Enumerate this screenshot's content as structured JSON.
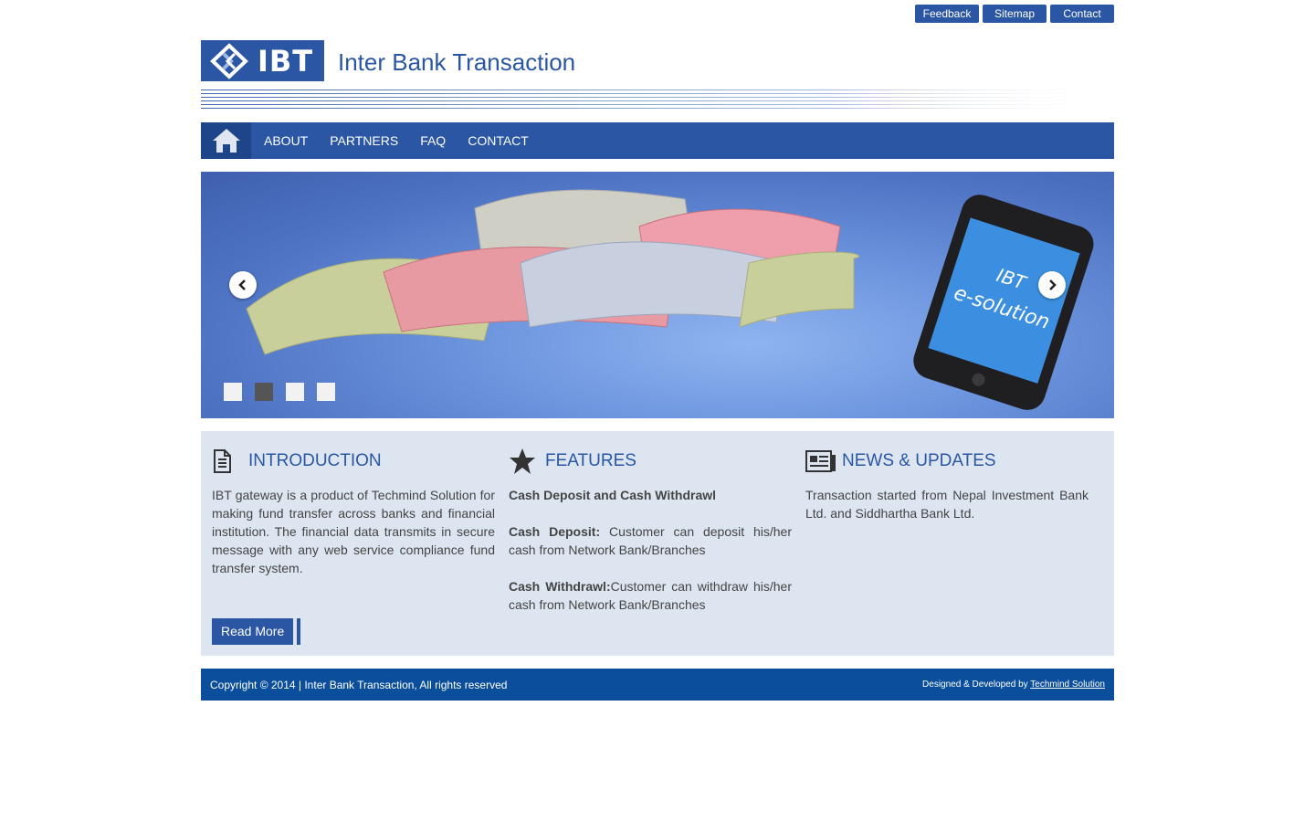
{
  "top_links": {
    "feedback": "Feedback",
    "sitemap": "Sitemap",
    "contact": "Contact"
  },
  "header": {
    "logo_text": "IBT",
    "site_title": "Inter Bank Transaction"
  },
  "nav": {
    "home_icon": "home-icon",
    "items": [
      "ABOUT",
      "PARTNERS",
      "FAQ",
      "CONTACT"
    ]
  },
  "slider": {
    "phone_text_line1": "IBT",
    "phone_text_line2": "e-solution",
    "active_slide": 2,
    "slide_count": 4
  },
  "introduction": {
    "title": "INTRODUCTION",
    "icon": "document-icon",
    "text": "IBT gateway is a product of Techmind Solution for making fund transfer across banks and financial institution. The financial data transmits in secure message with any web service compliance fund transfer system.",
    "read_more": "Read More"
  },
  "features": {
    "title": "FEATURES",
    "icon": "star-icon",
    "heading": "Cash Deposit and Cash Withdrawl",
    "items": [
      {
        "label": "Cash Deposit:",
        "text": " Customer can deposit his/her cash from Network Bank/Branches"
      },
      {
        "label": "Cash Withdrawl:",
        "text": "Customer can withdraw his/her cash from Network Bank/Branches"
      }
    ]
  },
  "news": {
    "title": "NEWS & UPDATES",
    "icon": "newspaper-icon",
    "text": "Transaction started from Nepal Investment Bank Ltd. and Siddhartha Bank Ltd."
  },
  "footer": {
    "copyright": "Copyright © 2014 | Inter Bank Transaction, All rights reserved",
    "credit_prefix": "Designed & Developed by ",
    "credit_link": "Techmind Solution"
  },
  "colors": {
    "primary": "#2a56a3",
    "nav_home": "#1e4589",
    "footer": "#0b4f9c",
    "content_bg": "#dde6f0"
  }
}
